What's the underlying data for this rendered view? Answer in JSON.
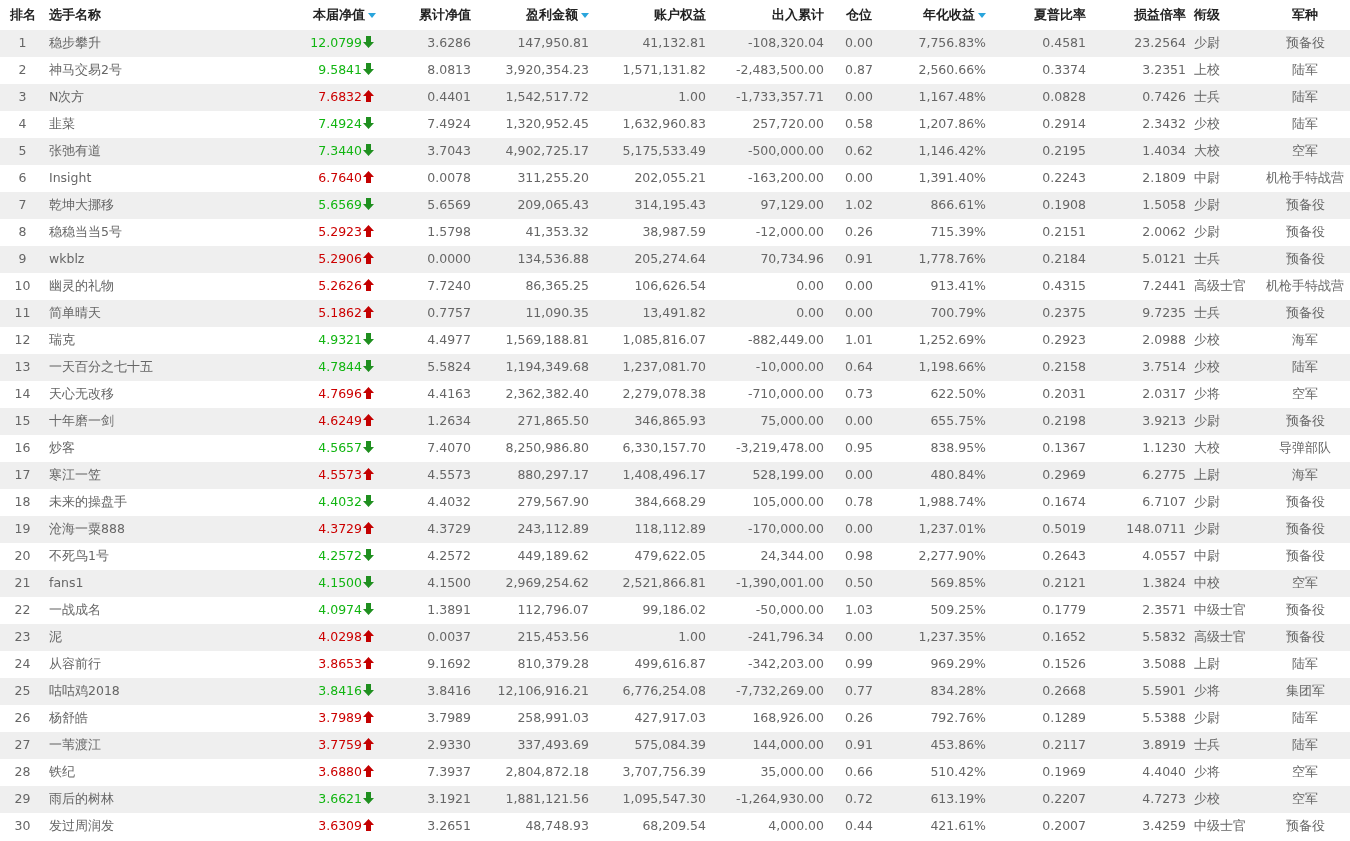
{
  "table": {
    "columns": [
      {
        "label": "排名",
        "sorted": false
      },
      {
        "label": "选手名称",
        "sorted": false
      },
      {
        "label": "本届净值",
        "sorted": true
      },
      {
        "label": "累计净值",
        "sorted": false
      },
      {
        "label": "盈利金额",
        "sorted": true
      },
      {
        "label": "账户权益",
        "sorted": false
      },
      {
        "label": "出入累计",
        "sorted": false
      },
      {
        "label": "仓位",
        "sorted": false
      },
      {
        "label": "年化收益",
        "sorted": true
      },
      {
        "label": "夏普比率",
        "sorted": false
      },
      {
        "label": "损益倍率",
        "sorted": false
      },
      {
        "label": "衔级",
        "sorted": false
      },
      {
        "label": "军种",
        "sorted": false
      }
    ],
    "rows": [
      {
        "cells": [
          "1",
          "稳步攀升",
          "12.0799",
          "3.6286",
          "147,950.81",
          "41,132.81",
          "-108,320.04",
          "0.00",
          "7,756.83%",
          "0.4581",
          "23.2564",
          "少尉",
          "预备役"
        ],
        "rising": false
      },
      {
        "cells": [
          "2",
          "神马交易2号",
          "9.5841",
          "8.0813",
          "3,920,354.23",
          "1,571,131.82",
          "-2,483,500.00",
          "0.87",
          "2,560.66%",
          "0.3374",
          "3.2351",
          "上校",
          "陆军"
        ],
        "rising": false
      },
      {
        "cells": [
          "3",
          "N次方",
          "7.6832",
          "0.4401",
          "1,542,517.72",
          "1.00",
          "-1,733,357.71",
          "0.00",
          "1,167.48%",
          "0.0828",
          "0.7426",
          "士兵",
          "陆军"
        ],
        "rising": true
      },
      {
        "cells": [
          "4",
          "韭菜",
          "7.4924",
          "7.4924",
          "1,320,952.45",
          "1,632,960.83",
          "257,720.00",
          "0.58",
          "1,207.86%",
          "0.2914",
          "2.3432",
          "少校",
          "陆军"
        ],
        "rising": false
      },
      {
        "cells": [
          "5",
          "张弛有道",
          "7.3440",
          "3.7043",
          "4,902,725.17",
          "5,175,533.49",
          "-500,000.00",
          "0.62",
          "1,146.42%",
          "0.2195",
          "1.4034",
          "大校",
          "空军"
        ],
        "rising": false
      },
      {
        "cells": [
          "6",
          "Insight",
          "6.7640",
          "0.0078",
          "311,255.20",
          "202,055.21",
          "-163,200.00",
          "0.00",
          "1,391.40%",
          "0.2243",
          "2.1809",
          "中尉",
          "机枪手特战营"
        ],
        "rising": true
      },
      {
        "cells": [
          "7",
          "乾坤大挪移",
          "5.6569",
          "5.6569",
          "209,065.43",
          "314,195.43",
          "97,129.00",
          "1.02",
          "866.61%",
          "0.1908",
          "1.5058",
          "少尉",
          "预备役"
        ],
        "rising": false
      },
      {
        "cells": [
          "8",
          "稳稳当当5号",
          "5.2923",
          "1.5798",
          "41,353.32",
          "38,987.59",
          "-12,000.00",
          "0.26",
          "715.39%",
          "0.2151",
          "2.0062",
          "少尉",
          "预备役"
        ],
        "rising": true
      },
      {
        "cells": [
          "9",
          "wkblz",
          "5.2906",
          "0.0000",
          "134,536.88",
          "205,274.64",
          "70,734.96",
          "0.91",
          "1,778.76%",
          "0.2184",
          "5.0121",
          "士兵",
          "预备役"
        ],
        "rising": true
      },
      {
        "cells": [
          "10",
          "幽灵的礼物",
          "5.2626",
          "7.7240",
          "86,365.25",
          "106,626.54",
          "0.00",
          "0.00",
          "913.41%",
          "0.4315",
          "7.2441",
          "高级士官",
          "机枪手特战营"
        ],
        "rising": true
      },
      {
        "cells": [
          "11",
          "简单晴天",
          "5.1862",
          "0.7757",
          "11,090.35",
          "13,491.82",
          "0.00",
          "0.00",
          "700.79%",
          "0.2375",
          "9.7235",
          "士兵",
          "预备役"
        ],
        "rising": true
      },
      {
        "cells": [
          "12",
          "瑞克",
          "4.9321",
          "4.4977",
          "1,569,188.81",
          "1,085,816.07",
          "-882,449.00",
          "1.01",
          "1,252.69%",
          "0.2923",
          "2.0988",
          "少校",
          "海军"
        ],
        "rising": false
      },
      {
        "cells": [
          "13",
          "一天百分之七十五",
          "4.7844",
          "5.5824",
          "1,194,349.68",
          "1,237,081.70",
          "-10,000.00",
          "0.64",
          "1,198.66%",
          "0.2158",
          "3.7514",
          "少校",
          "陆军"
        ],
        "rising": false
      },
      {
        "cells": [
          "14",
          "天心无改移",
          "4.7696",
          "4.4163",
          "2,362,382.40",
          "2,279,078.38",
          "-710,000.00",
          "0.73",
          "622.50%",
          "0.2031",
          "2.0317",
          "少将",
          "空军"
        ],
        "rising": true
      },
      {
        "cells": [
          "15",
          "十年磨一剑",
          "4.6249",
          "1.2634",
          "271,865.50",
          "346,865.93",
          "75,000.00",
          "0.00",
          "655.75%",
          "0.2198",
          "3.9213",
          "少尉",
          "预备役"
        ],
        "rising": true
      },
      {
        "cells": [
          "16",
          "炒客",
          "4.5657",
          "7.4070",
          "8,250,986.80",
          "6,330,157.70",
          "-3,219,478.00",
          "0.95",
          "838.95%",
          "0.1367",
          "1.1230",
          "大校",
          "导弹部队"
        ],
        "rising": false
      },
      {
        "cells": [
          "17",
          "寒江一笠",
          "4.5573",
          "4.5573",
          "880,297.17",
          "1,408,496.17",
          "528,199.00",
          "0.00",
          "480.84%",
          "0.2969",
          "6.2775",
          "上尉",
          "海军"
        ],
        "rising": true
      },
      {
        "cells": [
          "18",
          "未来的操盘手",
          "4.4032",
          "4.4032",
          "279,567.90",
          "384,668.29",
          "105,000.00",
          "0.78",
          "1,988.74%",
          "0.1674",
          "6.7107",
          "少尉",
          "预备役"
        ],
        "rising": false
      },
      {
        "cells": [
          "19",
          "沧海一粟888",
          "4.3729",
          "4.3729",
          "243,112.89",
          "118,112.89",
          "-170,000.00",
          "0.00",
          "1,237.01%",
          "0.5019",
          "148.0711",
          "少尉",
          "预备役"
        ],
        "rising": true
      },
      {
        "cells": [
          "20",
          "不死鸟1号",
          "4.2572",
          "4.2572",
          "449,189.62",
          "479,622.05",
          "24,344.00",
          "0.98",
          "2,277.90%",
          "0.2643",
          "4.0557",
          "中尉",
          "预备役"
        ],
        "rising": false
      },
      {
        "cells": [
          "21",
          "fans1",
          "4.1500",
          "4.1500",
          "2,969,254.62",
          "2,521,866.81",
          "-1,390,001.00",
          "0.50",
          "569.85%",
          "0.2121",
          "1.3824",
          "中校",
          "空军"
        ],
        "rising": false
      },
      {
        "cells": [
          "22",
          "一战成名",
          "4.0974",
          "1.3891",
          "112,796.07",
          "99,186.02",
          "-50,000.00",
          "1.03",
          "509.25%",
          "0.1779",
          "2.3571",
          "中级士官",
          "预备役"
        ],
        "rising": false
      },
      {
        "cells": [
          "23",
          "泥",
          "4.0298",
          "0.0037",
          "215,453.56",
          "1.00",
          "-241,796.34",
          "0.00",
          "1,237.35%",
          "0.1652",
          "5.5832",
          "高级士官",
          "预备役"
        ],
        "rising": true
      },
      {
        "cells": [
          "24",
          "从容前行",
          "3.8653",
          "9.1692",
          "810,379.28",
          "499,616.87",
          "-342,203.00",
          "0.99",
          "969.29%",
          "0.1526",
          "3.5088",
          "上尉",
          "陆军"
        ],
        "rising": true
      },
      {
        "cells": [
          "25",
          "咕咕鸡2018",
          "3.8416",
          "3.8416",
          "12,106,916.21",
          "6,776,254.08",
          "-7,732,269.00",
          "0.77",
          "834.28%",
          "0.2668",
          "5.5901",
          "少将",
          "集团军"
        ],
        "rising": false
      },
      {
        "cells": [
          "26",
          "杨舒皓",
          "3.7989",
          "3.7989",
          "258,991.03",
          "427,917.03",
          "168,926.00",
          "0.26",
          "792.76%",
          "0.1289",
          "5.5388",
          "少尉",
          "陆军"
        ],
        "rising": true
      },
      {
        "cells": [
          "27",
          "一苇渡江",
          "3.7759",
          "2.9330",
          "337,493.69",
          "575,084.39",
          "144,000.00",
          "0.91",
          "453.86%",
          "0.2117",
          "3.8919",
          "士兵",
          "陆军"
        ],
        "rising": true
      },
      {
        "cells": [
          "28",
          "铁纪",
          "3.6880",
          "7.3937",
          "2,804,872.18",
          "3,707,756.39",
          "35,000.00",
          "0.66",
          "510.42%",
          "0.1969",
          "4.4040",
          "少将",
          "空军"
        ],
        "rising": true
      },
      {
        "cells": [
          "29",
          "雨后的树林",
          "3.6621",
          "3.1921",
          "1,881,121.56",
          "1,095,547.30",
          "-1,264,930.00",
          "0.72",
          "613.19%",
          "0.2207",
          "4.7273",
          "少校",
          "空军"
        ],
        "rising": false
      },
      {
        "cells": [
          "30",
          "发过周润发",
          "3.6309",
          "3.2651",
          "48,748.93",
          "68,209.54",
          "4,000.00",
          "0.44",
          "421.61%",
          "0.2007",
          "3.4259",
          "中级士官",
          "预备役"
        ],
        "rising": true
      }
    ]
  }
}
